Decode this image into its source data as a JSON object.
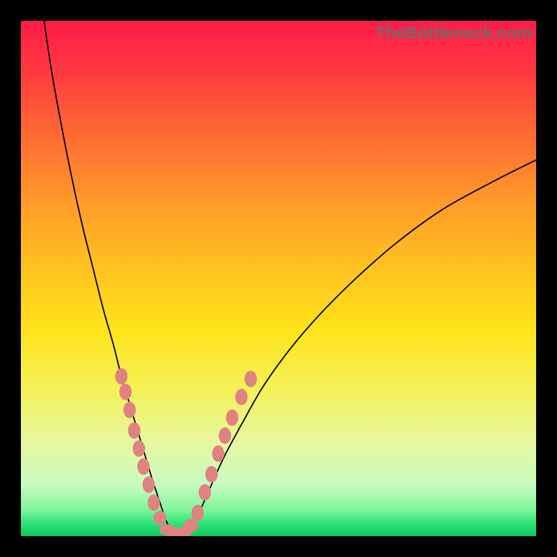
{
  "watermark": "TheBottleneck.com",
  "colors": {
    "black": "#000000",
    "curve": "#000000",
    "marker": "#e18282",
    "gradient_stops": [
      {
        "offset": 0.0,
        "color": "#ff1a4a"
      },
      {
        "offset": 0.1,
        "color": "#ff3a3f"
      },
      {
        "offset": 0.22,
        "color": "#ff6a33"
      },
      {
        "offset": 0.35,
        "color": "#ff9a2a"
      },
      {
        "offset": 0.48,
        "color": "#ffc21f"
      },
      {
        "offset": 0.6,
        "color": "#ffe31a"
      },
      {
        "offset": 0.72,
        "color": "#f3f25a"
      },
      {
        "offset": 0.82,
        "color": "#e6f8a0"
      },
      {
        "offset": 0.9,
        "color": "#c8fbc0"
      },
      {
        "offset": 0.95,
        "color": "#7ff59a"
      },
      {
        "offset": 0.975,
        "color": "#2ee37a"
      },
      {
        "offset": 1.0,
        "color": "#0dc95e"
      }
    ]
  },
  "chart_data": {
    "type": "line",
    "title": "",
    "xlabel": "",
    "ylabel": "",
    "xlim": [
      0,
      100
    ],
    "ylim": [
      0,
      100
    ],
    "grid": false,
    "legend": false,
    "series": [
      {
        "name": "bottleneck-curve",
        "x": [
          4.5,
          6,
          8,
          10,
          12,
          14,
          16,
          18,
          19.5,
          21,
          22.5,
          24,
          25.5,
          27,
          28,
          29,
          30,
          31.5,
          33,
          35,
          37,
          39.5,
          43,
          47,
          52,
          58,
          65,
          73,
          82,
          92,
          100
        ],
        "y": [
          100,
          90,
          79,
          69,
          60,
          52,
          44,
          37,
          31,
          26,
          21,
          16,
          11,
          6.5,
          3.5,
          1.4,
          0.6,
          0.6,
          1.8,
          5.5,
          10,
          15.5,
          22,
          29,
          36,
          43,
          50,
          57,
          63.5,
          69,
          73
        ]
      }
    ],
    "markers": {
      "name": "highlight-points",
      "points": [
        {
          "x": 19.5,
          "y": 31,
          "rx": 1.2,
          "ry": 1.6
        },
        {
          "x": 20.3,
          "y": 28,
          "rx": 1.2,
          "ry": 1.6
        },
        {
          "x": 21.1,
          "y": 24.5,
          "rx": 1.2,
          "ry": 1.6
        },
        {
          "x": 22.0,
          "y": 20.5,
          "rx": 1.2,
          "ry": 1.6
        },
        {
          "x": 22.9,
          "y": 17,
          "rx": 1.2,
          "ry": 1.6
        },
        {
          "x": 23.8,
          "y": 13.5,
          "rx": 1.2,
          "ry": 1.6
        },
        {
          "x": 24.8,
          "y": 10,
          "rx": 1.2,
          "ry": 1.6
        },
        {
          "x": 25.8,
          "y": 6.5,
          "rx": 1.2,
          "ry": 1.6
        },
        {
          "x": 27.0,
          "y": 3.5,
          "rx": 1.3,
          "ry": 1.4
        },
        {
          "x": 28.5,
          "y": 1.2,
          "rx": 1.6,
          "ry": 1.1
        },
        {
          "x": 30.0,
          "y": 0.6,
          "rx": 1.6,
          "ry": 1.1
        },
        {
          "x": 31.5,
          "y": 0.7,
          "rx": 1.6,
          "ry": 1.1
        },
        {
          "x": 33.0,
          "y": 2.0,
          "rx": 1.4,
          "ry": 1.3
        },
        {
          "x": 34.3,
          "y": 4.5,
          "rx": 1.2,
          "ry": 1.6
        },
        {
          "x": 35.7,
          "y": 8.5,
          "rx": 1.2,
          "ry": 1.6
        },
        {
          "x": 37.0,
          "y": 12.0,
          "rx": 1.2,
          "ry": 1.6
        },
        {
          "x": 38.3,
          "y": 16.0,
          "rx": 1.2,
          "ry": 1.6
        },
        {
          "x": 39.6,
          "y": 19.5,
          "rx": 1.2,
          "ry": 1.6
        },
        {
          "x": 41.0,
          "y": 23.0,
          "rx": 1.2,
          "ry": 1.6
        },
        {
          "x": 42.8,
          "y": 27.0,
          "rx": 1.2,
          "ry": 1.6
        },
        {
          "x": 44.6,
          "y": 30.5,
          "rx": 1.2,
          "ry": 1.6
        }
      ]
    }
  }
}
